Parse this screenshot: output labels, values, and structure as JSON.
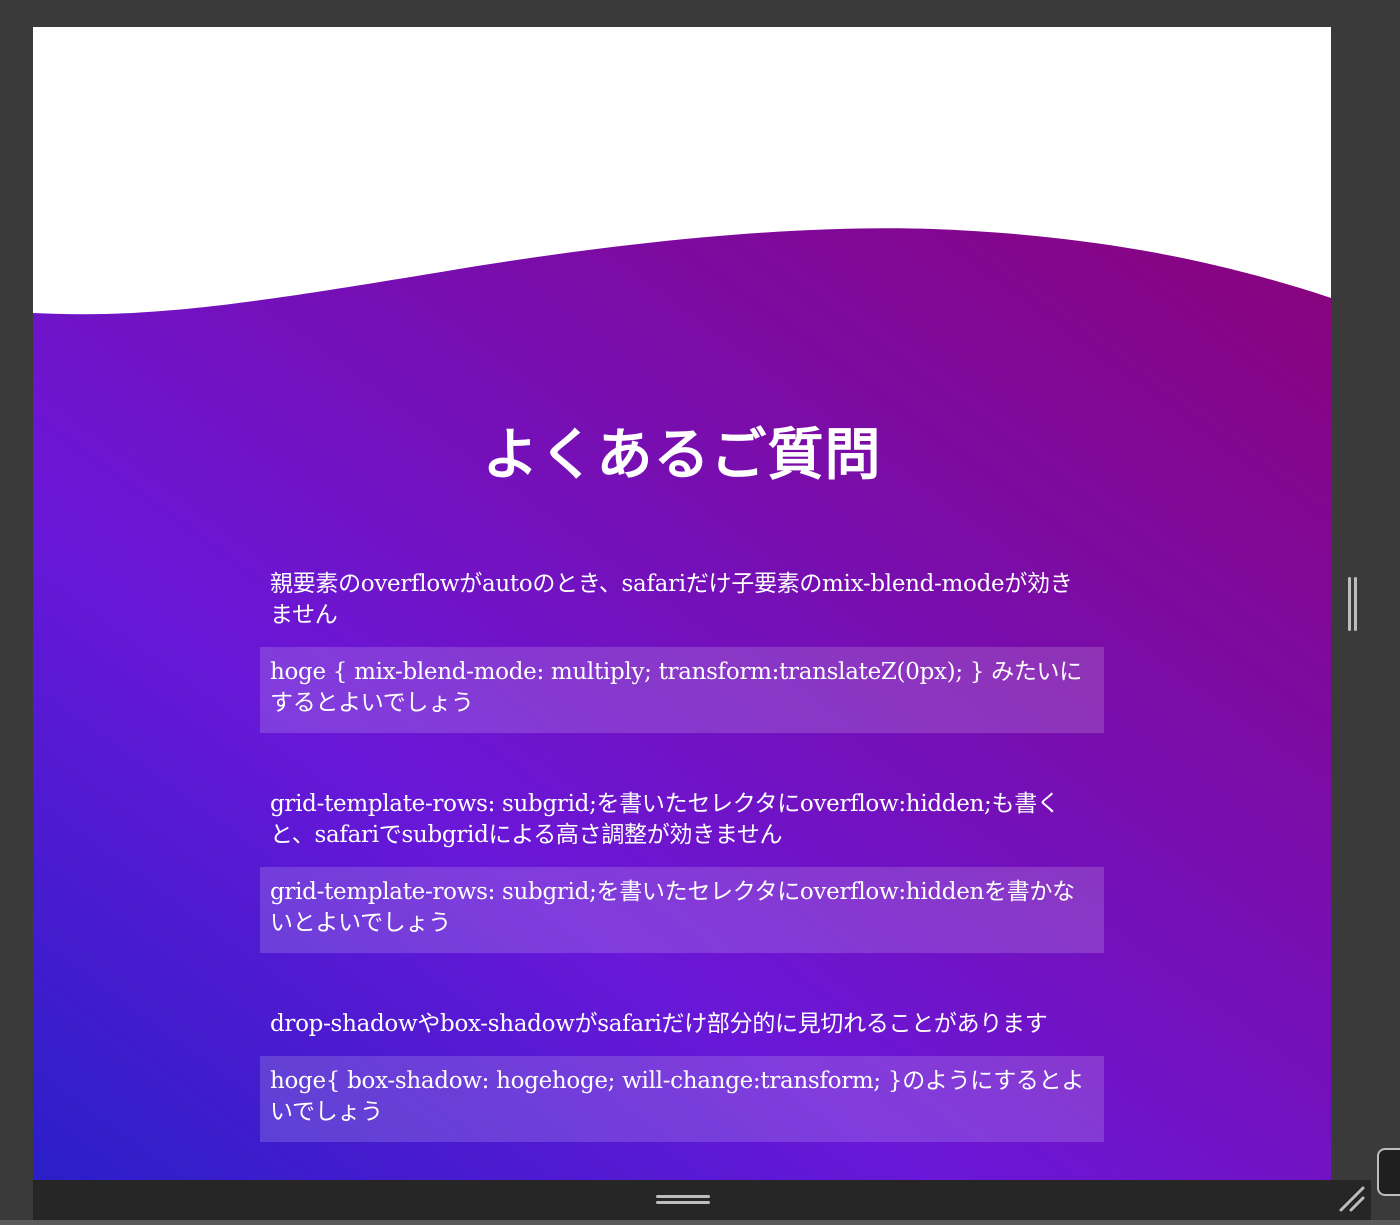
{
  "faq": {
    "title": "よくあるご質問",
    "items": [
      {
        "question": "親要素のoverflowがautoのとき、safariだけ子要素のmix-blend-modeが効きません",
        "answer": "hoge { mix-blend-mode: multiply; transform:translateZ(0px); } みたいにするとよいでしょう"
      },
      {
        "question": "grid-template-rows: subgrid;を書いたセレクタにoverflow:hidden;も書くと、safariでsubgridによる高さ調整が効きません",
        "answer": "grid-template-rows: subgrid;を書いたセレクタにoverflow:hiddenを書かないとよいでしょう"
      },
      {
        "question": "drop-shadowやbox-shadowがsafariだけ部分的に見切れることがあります",
        "answer": "hoge{ box-shadow: hogehoge; will-change:transform; }のようにするとよいでしょう"
      }
    ]
  },
  "theme": {
    "gradient_start": "#2a1fc8",
    "gradient_mid": "#6a17d8",
    "gradient_end": "#8a027a",
    "page_background": "#ffffff",
    "chrome_background": "#3a3a3a",
    "chrome_bar": "#262626"
  },
  "icons": {
    "side_grip": "vertical-resize-grip-icon",
    "bottom_grip": "horizontal-resize-grip-icon",
    "corner": "resize-corner-icon"
  }
}
